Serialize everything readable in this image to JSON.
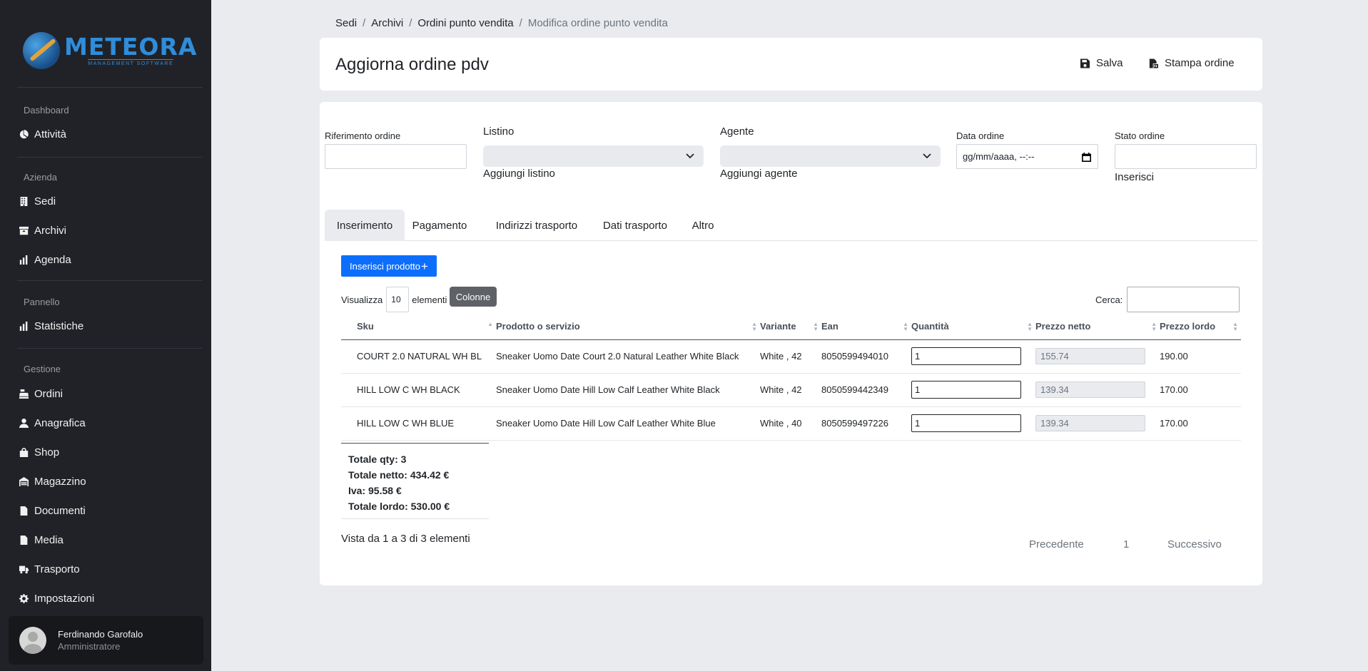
{
  "brand": {
    "name": "METEORA",
    "tagline": "MANAGEMENT SOFTWARE"
  },
  "sidebar": {
    "sections": [
      {
        "title": "Dashboard",
        "items": [
          {
            "label": "Attività",
            "icon": "chart-pie-icon"
          }
        ]
      },
      {
        "title": "Azienda",
        "items": [
          {
            "label": "Sedi",
            "icon": "building-icon"
          },
          {
            "label": "Archivi",
            "icon": "archive-icon"
          },
          {
            "label": "Agenda",
            "icon": "bar-chart-icon"
          }
        ]
      },
      {
        "title": "Pannello",
        "items": [
          {
            "label": "Statistiche",
            "icon": "bar-chart-icon"
          }
        ]
      },
      {
        "title": "Gestione",
        "items": [
          {
            "label": "Ordini",
            "icon": "cash-register-icon"
          },
          {
            "label": "Anagrafica",
            "icon": "user-icon"
          },
          {
            "label": "Shop",
            "icon": "shopping-bag-icon"
          },
          {
            "label": "Magazzino",
            "icon": "warehouse-icon"
          },
          {
            "label": "Documenti",
            "icon": "file-icon"
          },
          {
            "label": "Media",
            "icon": "file-icon"
          },
          {
            "label": "Trasporto",
            "icon": "truck-icon"
          },
          {
            "label": "Impostazioni",
            "icon": "gear-icon"
          }
        ]
      }
    ],
    "user": {
      "name": "Ferdinando Garofalo",
      "role": "Amministratore"
    }
  },
  "breadcrumb": [
    "Sedi",
    "Archivi",
    "Ordini punto vendita"
  ],
  "breadcrumb_current": "Modifica ordine punto vendita",
  "header": {
    "title": "Aggiorna ordine pdv",
    "save_label": "Salva",
    "print_label": "Stampa ordine"
  },
  "form": {
    "reference_label": "Riferimento ordine",
    "reference_value": "",
    "pricelist_label": "Listino",
    "pricelist_add": "Aggiungi listino",
    "agent_label": "Agente",
    "agent_add": "Aggiungi agente",
    "date_label": "Data ordine",
    "date_placeholder": "gg/mm/aaaa, --:--",
    "status_label": "Stato ordine",
    "status_add": "Inserisci"
  },
  "tabs": [
    "Inserimento",
    "Pagamento",
    "Indirizzi trasporto",
    "Dati trasporto",
    "Altro"
  ],
  "active_tab": "Inserimento",
  "insert_product_label": "Inserisci prodotto",
  "table_controls": {
    "show_label": "Visualizza",
    "page_length": "10",
    "elements_label": "elementi",
    "columns_tooltip": "Colonne",
    "search_label": "Cerca:"
  },
  "table": {
    "columns": [
      "Sku",
      "Prodotto o servizio",
      "Variante",
      "Ean",
      "Quantità",
      "Prezzo netto",
      "Prezzo lordo"
    ],
    "rows": [
      {
        "sku": "COURT 2.0 NATURAL WH BL",
        "product": "Sneaker Uomo Date Court 2.0 Natural Leather White Black",
        "variant": "White , 42",
        "ean": "8050599494010",
        "qty": "1",
        "net": "155.74",
        "gross": "190.00"
      },
      {
        "sku": "HILL LOW C WH BLACK",
        "product": "Sneaker Uomo Date Hill Low Calf Leather White Black",
        "variant": "White , 42",
        "ean": "8050599442349",
        "qty": "1",
        "net": "139.34",
        "gross": "170.00"
      },
      {
        "sku": "HILL LOW C WH BLUE",
        "product": "Sneaker Uomo Date Hill Low Calf Leather White Blue",
        "variant": "White , 40",
        "ean": "8050599497226",
        "qty": "1",
        "net": "139.34",
        "gross": "170.00"
      }
    ]
  },
  "totals": {
    "qty": "Totale qty: 3",
    "net": "Totale netto: 434.42 €",
    "vat": "Iva: 95.58 €",
    "gross": "Totale lordo: 530.00 €"
  },
  "pagination": {
    "info": "Vista da 1 a 3 di 3 elementi",
    "prev": "Precedente",
    "page": "1",
    "next": "Successivo"
  },
  "colors": {
    "sidebar_bg": "#212227",
    "primary": "#0d6efd",
    "page_bg": "#e9ebef",
    "logo": "#2f8ddb"
  }
}
